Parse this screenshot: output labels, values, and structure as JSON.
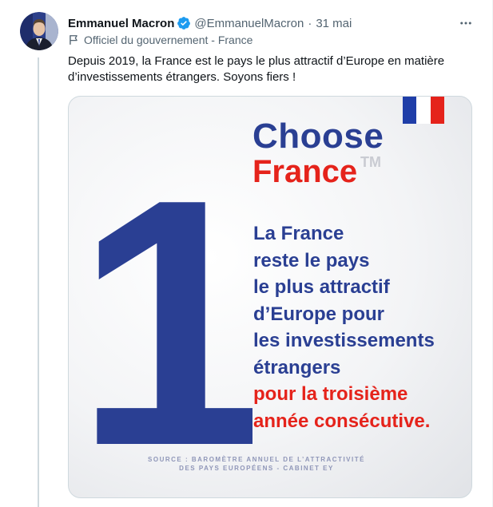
{
  "author": {
    "name": "Emmanuel Macron",
    "handle": "@EmmanuelMacron",
    "separator": "·",
    "date": "31 mai",
    "label": "Officiel du gouvernement - France"
  },
  "tweet": {
    "text": "Depuis 2019, la France est le pays le plus attractif d’Europe en matière d’investissements étrangers. Soyons fiers !"
  },
  "media": {
    "brand_line1": "Choose",
    "brand_line2": "France",
    "trademark": "TM",
    "lines_blue": [
      "La France",
      "reste le pays",
      "le plus attractif",
      "d’Europe pour",
      "les investissements",
      "étrangers"
    ],
    "lines_red": [
      "pour la troisième",
      "année consécutive."
    ],
    "source_line1": "SOURCE : BAROMÈTRE ANNUEL DE L’ATTRACTIVITÉ",
    "source_line2": "DES PAYS EUROPÉENS - CABINET EY",
    "big_number": "1"
  },
  "icons": {
    "verified": "verified-badge-icon",
    "more": "more-options-icon",
    "label": "flag-outline-icon"
  },
  "colors": {
    "choose_blue": "#2a3f93",
    "france_red": "#e5231b",
    "verified_blue": "#1d9bf0",
    "muted_text": "#536471"
  }
}
